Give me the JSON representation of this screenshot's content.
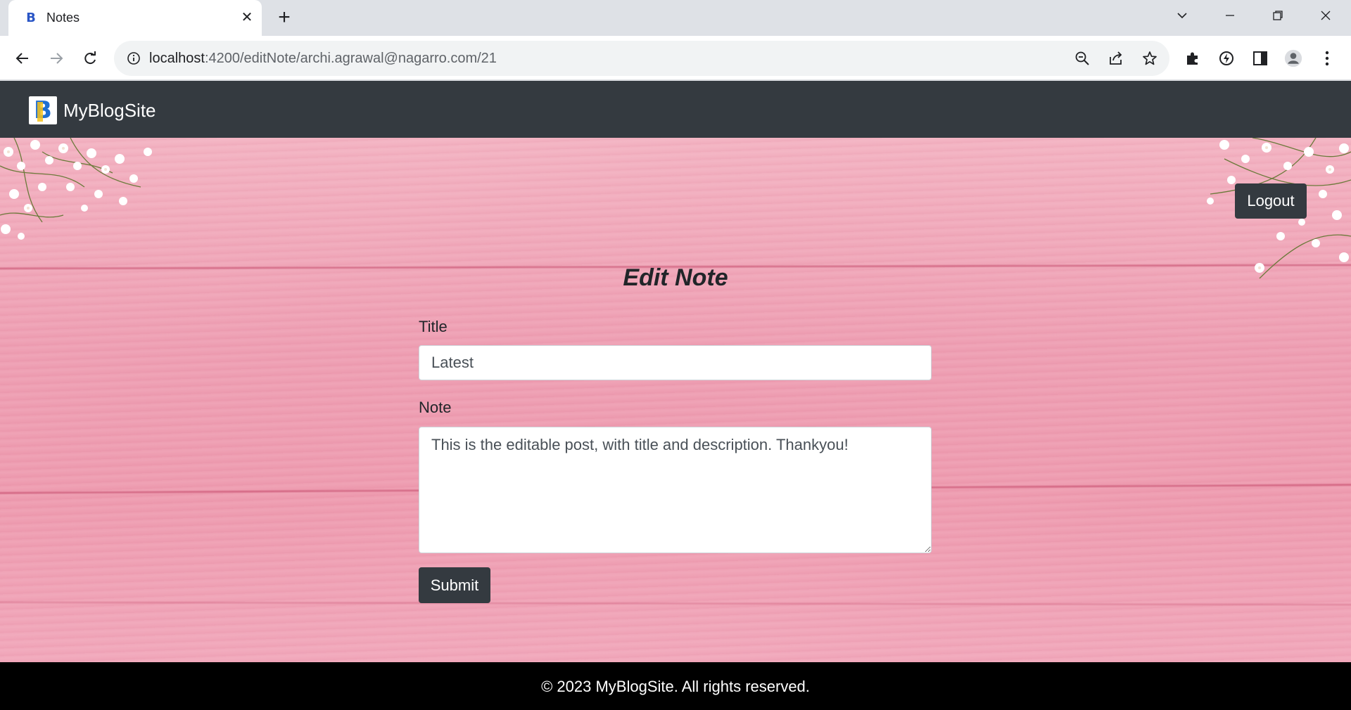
{
  "browser": {
    "tab_title": "Notes",
    "tab_favicon_letter": "B",
    "url_host": "localhost",
    "url_rest": ":4200/editNote/archi.agrawal@nagarro.com/21",
    "icons": [
      "tab-close-icon",
      "new-tab-icon",
      "tab-search-icon",
      "minimize-icon",
      "restore-icon",
      "window-close-icon",
      "back-arrow-icon",
      "forward-arrow-icon",
      "reload-icon",
      "site-info-icon",
      "zoom-out-icon",
      "share-icon",
      "bookmark-star-icon",
      "extensions-icon",
      "performance-icon",
      "side-panel-icon",
      "profile-icon",
      "menu-icon"
    ]
  },
  "navbar": {
    "brand_logo_letter": "B",
    "brand_name": "MyBlogSite",
    "bg_color": "#343a40"
  },
  "page": {
    "logout_label": "Logout",
    "form_title": "Edit Note",
    "title_label": "Title",
    "title_value": "Latest",
    "note_label": "Note",
    "note_value": "This is the editable post, with title and description. Thankyou!",
    "submit_label": "Submit"
  },
  "footer": {
    "text": "© 2023 MyBlogSite. All rights reserved."
  },
  "colors": {
    "background_pink": "#ee9fb3",
    "button_dark": "#343a40",
    "footer_bg": "#000000"
  }
}
